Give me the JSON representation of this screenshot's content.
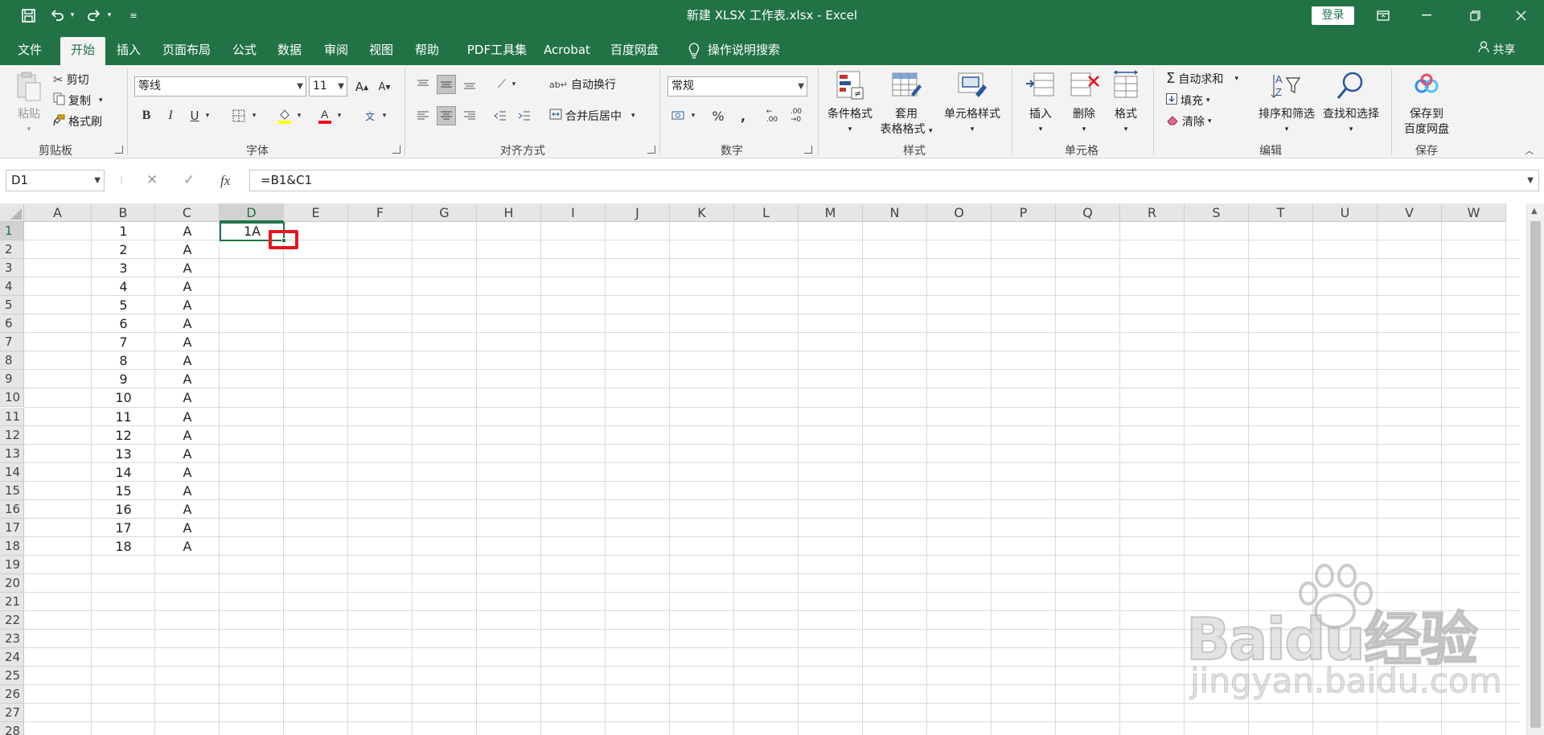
{
  "window": {
    "title": "新建 XLSX 工作表.xlsx  -  Excel",
    "login": "登录",
    "quick_access": {
      "save": "save-icon",
      "undo": "undo-icon",
      "redo": "redo-icon",
      "customize": "customize-icon"
    }
  },
  "menu": {
    "tabs": [
      "文件",
      "开始",
      "插入",
      "页面布局",
      "公式",
      "数据",
      "审阅",
      "视图",
      "帮助",
      "PDF工具集",
      "Acrobat",
      "百度网盘"
    ],
    "active_tab": "开始",
    "tell_me": "操作说明搜索",
    "share": "共享"
  },
  "ribbon": {
    "clipboard": {
      "paste": "粘贴",
      "cut": "剪切",
      "copy": "复制",
      "format_painter": "格式刷",
      "label": "剪贴板"
    },
    "font": {
      "font_name": "等线",
      "font_size": "11",
      "grow": "A",
      "shrink": "A",
      "bold": "B",
      "italic": "I",
      "underline": "U",
      "phonetic": "文",
      "label": "字体"
    },
    "alignment": {
      "wrap_text": "自动换行",
      "merge_center": "合并后居中",
      "label": "对齐方式"
    },
    "number": {
      "format": "常规",
      "percent": "%",
      "comma": ",",
      "inc_decimal": ".00",
      "dec_decimal": ".00",
      "label": "数字"
    },
    "styles": {
      "conditional": "条件格式",
      "as_table_1": "套用",
      "as_table_2": "表格格式",
      "cell_styles": "单元格样式",
      "label": "样式"
    },
    "cells": {
      "insert": "插入",
      "delete": "删除",
      "format": "格式",
      "label": "单元格"
    },
    "editing": {
      "autosum": "自动求和",
      "fill": "填充",
      "clear": "清除",
      "sort_filter": "排序和筛选",
      "find_select": "查找和选择",
      "label": "编辑"
    },
    "save": {
      "save_to_1": "保存到",
      "save_to_2": "百度网盘",
      "label": "保存"
    }
  },
  "formula_bar": {
    "name_box": "D1",
    "cancel": "✕",
    "enter": "✓",
    "fx": "fx",
    "formula": "=B1&C1"
  },
  "sheet": {
    "columns": [
      "A",
      "B",
      "C",
      "D",
      "E",
      "F",
      "G",
      "H",
      "I",
      "J",
      "K",
      "L",
      "M",
      "N",
      "O",
      "P",
      "Q",
      "R",
      "S",
      "T",
      "U",
      "V",
      "W"
    ],
    "rows": [
      "1",
      "2",
      "3",
      "4",
      "5",
      "6",
      "7",
      "8",
      "9",
      "10",
      "11",
      "12",
      "13",
      "14",
      "15",
      "16",
      "17",
      "18",
      "19",
      "20",
      "21",
      "22",
      "23",
      "24",
      "25",
      "26",
      "27",
      "28"
    ],
    "col_b": [
      "1",
      "2",
      "3",
      "4",
      "5",
      "6",
      "7",
      "8",
      "9",
      "10",
      "11",
      "12",
      "13",
      "14",
      "15",
      "16",
      "17",
      "18"
    ],
    "col_c": [
      "A",
      "A",
      "A",
      "A",
      "A",
      "A",
      "A",
      "A",
      "A",
      "A",
      "A",
      "A",
      "A",
      "A",
      "A",
      "A",
      "A",
      "A"
    ],
    "d1": "1A",
    "selected_cell": "D1",
    "highlight_color": "#e8141c"
  },
  "watermark": {
    "line1": "Baidu经验",
    "line2": "jingyan.baidu.com"
  },
  "colors": {
    "excel_green": "#217346",
    "ribbon_bg": "#f3f3f3",
    "header_bg": "#e6e6e6"
  }
}
